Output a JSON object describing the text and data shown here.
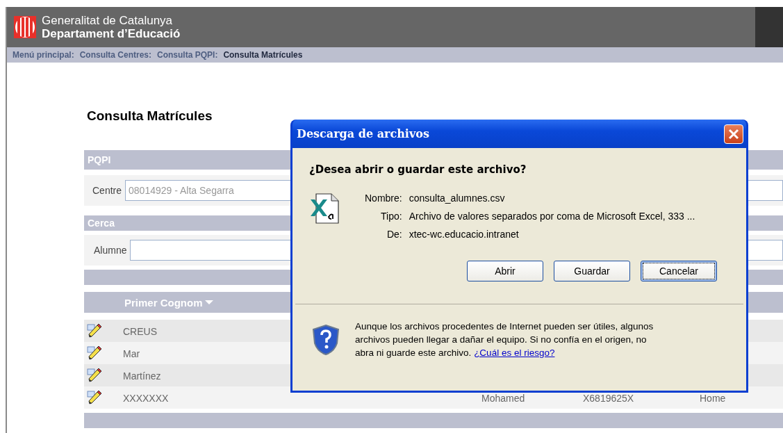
{
  "header": {
    "title": "Generalitat de Catalunya",
    "subtitle": "Departament d’Educació"
  },
  "breadcrumb": [
    {
      "label": "Menú principal:",
      "selected": false
    },
    {
      "label": "Consulta Centres:",
      "selected": false
    },
    {
      "label": "Consulta PQPI:",
      "selected": false
    },
    {
      "label": "Consulta Matrícules",
      "selected": true
    }
  ],
  "page_title": "Consulta Matrícules",
  "pqpi": {
    "heading": "PQPI",
    "label": "Centre",
    "value": "08014929 - Alta Segarra"
  },
  "search": {
    "heading": "Cerca",
    "label": "Alumne"
  },
  "table": {
    "sort_column": "Primer Cognom",
    "rows": [
      {
        "surname": "CREUS"
      },
      {
        "surname": "Mar"
      },
      {
        "surname": "Martínez"
      },
      {
        "surname": "XXXXXXX",
        "column_2": "Mohamed",
        "column_3": "X6819625X",
        "column_4": "Home"
      }
    ]
  },
  "dialog": {
    "title": "Descarga de archivos",
    "question": "¿Desea abrir o guardar este archivo?",
    "fields": [
      {
        "label": "Nombre:",
        "value": "consulta_alumnes.csv"
      },
      {
        "label": "Tipo:",
        "value": "Archivo de valores separados por coma de Microsoft Excel, 333 ..."
      },
      {
        "label": "De:",
        "value": "xtec-wc.educacio.intranet"
      }
    ],
    "buttons": [
      {
        "label": "Abrir",
        "focused": false
      },
      {
        "label": "Guardar",
        "focused": false
      },
      {
        "label": "Cancelar",
        "focused": true
      }
    ],
    "warning": "Aunque los archivos procedentes de Internet pueden ser útiles, algunos archivos pueden llegar a dañar el equipo. Si no confía en el origen, no abra ni guarde este archivo.",
    "link": "¿Cuál es el riesgo?"
  }
}
